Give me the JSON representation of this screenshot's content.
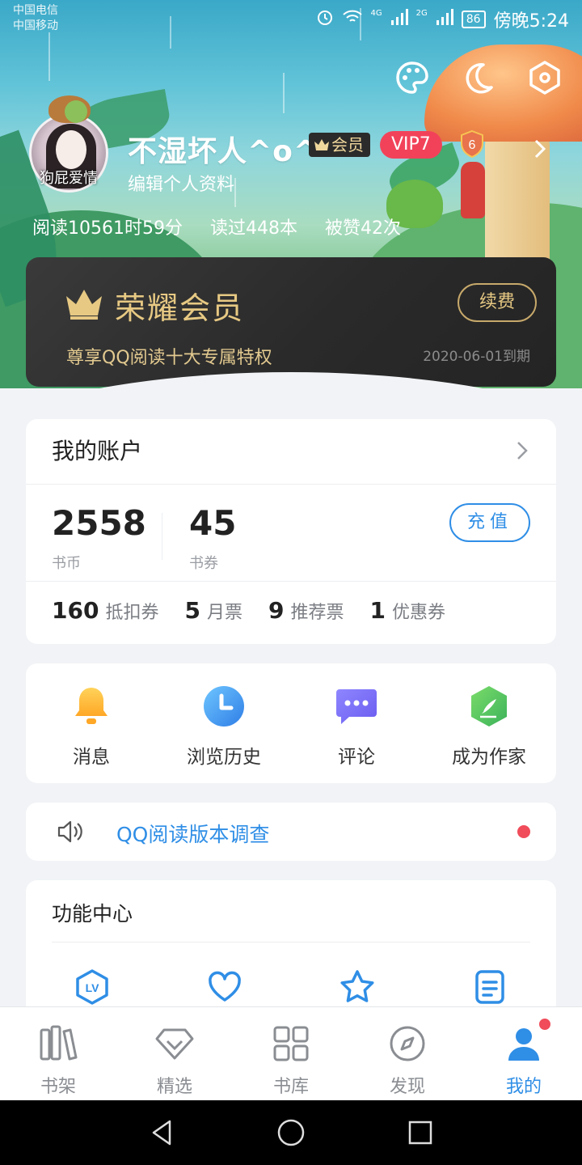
{
  "status_bar": {
    "carrier_1": "中国电信",
    "carrier_2": "中国移动",
    "network_1": "4G",
    "network_2": "2G",
    "battery": "86",
    "time": "傍晚5:24"
  },
  "profile": {
    "avatar_caption": "狗屁爱情",
    "username": "不湿坏人^o^",
    "member_badge": "会员",
    "vip_badge": "VIP7",
    "level_badge": "6",
    "edit_link": "编辑个人资料",
    "stats": [
      "阅读10561时59分",
      "读过448本",
      "被赞42次"
    ]
  },
  "honor_card": {
    "title": "荣耀会员",
    "subtitle": "尊享QQ阅读十大专属特权",
    "expiry": "2020-06-01到期",
    "renew_label": "续费"
  },
  "account": {
    "title": "我的账户",
    "coins_value": "2558",
    "coins_label": "书币",
    "vouchers_value": "45",
    "vouchers_label": "书券",
    "recharge_label": "充值",
    "tickets": [
      {
        "count": "160",
        "label": "抵扣券"
      },
      {
        "count": "5",
        "label": "月票"
      },
      {
        "count": "9",
        "label": "推荐票"
      },
      {
        "count": "1",
        "label": "优惠券"
      }
    ]
  },
  "shortcuts": [
    {
      "label": "消息",
      "icon": "bell-icon"
    },
    {
      "label": "浏览历史",
      "icon": "clock-icon"
    },
    {
      "label": "评论",
      "icon": "comment-icon"
    },
    {
      "label": "成为作家",
      "icon": "quill-icon"
    }
  ],
  "survey": {
    "text": "QQ阅读版本调查"
  },
  "function_center": {
    "title": "功能中心",
    "icons": [
      "level-icon",
      "heart-icon",
      "star-icon",
      "notes-icon"
    ]
  },
  "bottom_nav": {
    "tabs": [
      {
        "label": "书架",
        "icon": "bookshelf-icon"
      },
      {
        "label": "精选",
        "icon": "diamond-icon"
      },
      {
        "label": "书库",
        "icon": "grid-icon"
      },
      {
        "label": "发现",
        "icon": "compass-icon"
      },
      {
        "label": "我的",
        "icon": "profile-icon"
      }
    ],
    "active_tab": "我的"
  },
  "colors": {
    "accent_blue": "#2f8ee6",
    "gold": "#e7c983",
    "vip_red": "#f2425a",
    "notification_red": "#f04c5a"
  }
}
